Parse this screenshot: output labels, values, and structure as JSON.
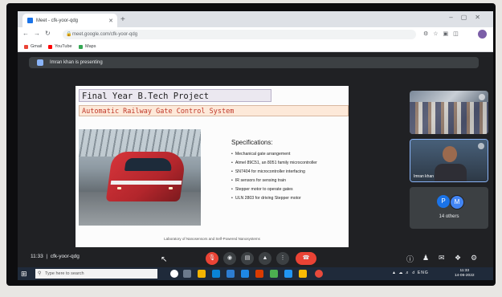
{
  "browser": {
    "tab_title": "Meet - cfk-yoor-qdg",
    "tab_close": "✕",
    "new_tab": "+",
    "window_controls": "–▢✕",
    "url": "meet.google.com/cfk-yoor-qdg",
    "bookmarks": [
      {
        "label": "Gmail",
        "color": "#ea4335"
      },
      {
        "label": "YouTube",
        "color": "#ff0000"
      },
      {
        "label": "Maps",
        "color": "#34a853"
      }
    ]
  },
  "meet": {
    "presenting_text": "Imran khan is presenting",
    "meeting_time": "11:33",
    "meeting_code": "cfk-yoor-qdg",
    "participants": {
      "self_name": "Imran khan",
      "initials": [
        "P",
        "M"
      ],
      "others_count": "14 others"
    }
  },
  "slide": {
    "title": "Final Year B.Tech Project",
    "subtitle": "Automatic Railway Gate Control System",
    "specs_heading": "Specifications:",
    "specs": [
      "Mechanical gate arrangement",
      "Atmel 89C51, an 8051 family microcontroller",
      "SN7404 for microcontroller interfacing",
      "IR sensors for sensing train",
      "Stepper motor to operate gates",
      "ULN 2803 for driving Stepper motor"
    ],
    "footer": "Laboratory of Nanosensors and Self-Powered Nanosystems"
  },
  "taskbar": {
    "search_placeholder": "Type here to search",
    "language": "ENG",
    "time": "11:33",
    "date": "14-06-2022"
  },
  "colors": {
    "meet_bg": "#202124",
    "hangup": "#ea4335",
    "accent": "#8ab4f8",
    "taskbar": "#1f2a3a"
  }
}
